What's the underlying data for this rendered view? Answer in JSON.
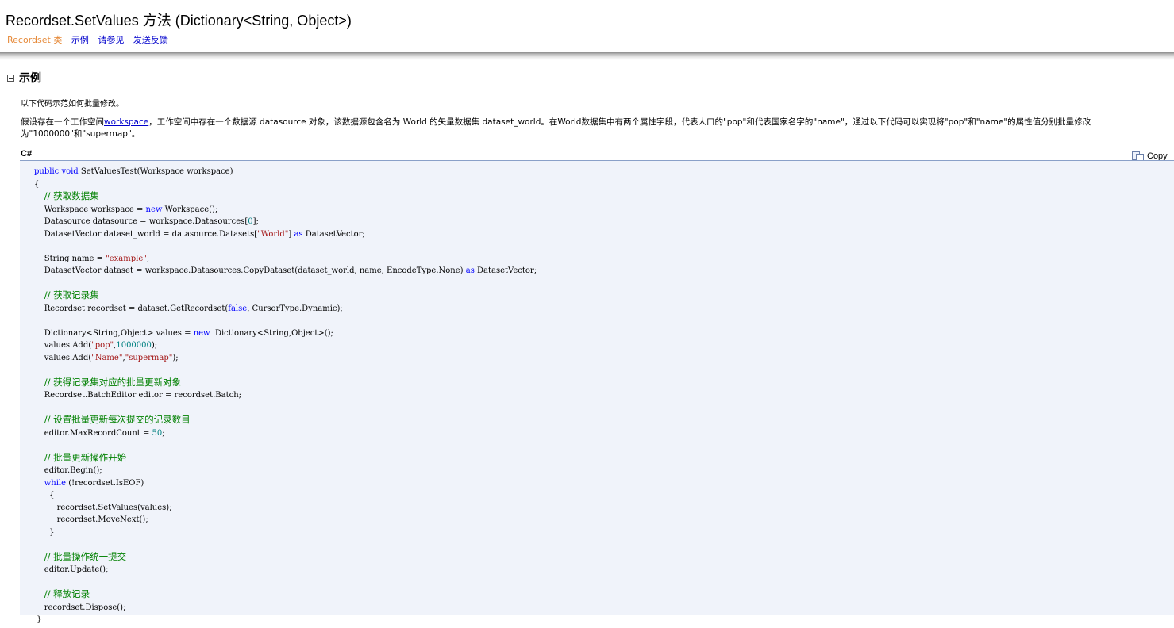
{
  "header": {
    "title": "Recordset.SetValues 方法 (Dictionary<String, Object>)",
    "links": [
      {
        "label": "Recordset 类",
        "visited": true
      },
      {
        "label": "示例",
        "visited": false
      },
      {
        "label": "请参见",
        "visited": false
      },
      {
        "label": "发送反馈",
        "visited": false
      }
    ]
  },
  "section": {
    "title": "示例",
    "intro1": "以下代码示范如何批量修改。",
    "intro2_prefix": "假设存在一个工作空间",
    "intro2_link": "workspace",
    "intro2_suffix": "，工作空间中存在一个数据源 datasource 对象，该数据源包含名为 World 的矢量数据集 dataset_world。在World数据集中有两个属性字段，代表人口的\"pop\"和代表国家名字的\"name\"，通过以下代码可以实现将\"pop\"和\"name\"的属性值分别批量修改为\"1000000\"和\"supermap\"。",
    "language": "C#",
    "copy_label": "Copy"
  },
  "code": {
    "lines": [
      [
        {
          "t": "kw",
          "v": "public"
        },
        {
          "t": "txt",
          "v": " "
        },
        {
          "t": "kw",
          "v": "void"
        },
        {
          "t": "txt",
          "v": " SetValuesTest(Workspace workspace)"
        }
      ],
      [
        {
          "t": "txt",
          "v": "{"
        }
      ],
      [
        {
          "t": "txt",
          "v": "    "
        },
        {
          "t": "cm",
          "v": "// 获取数据集"
        }
      ],
      [
        {
          "t": "txt",
          "v": "    Workspace workspace = "
        },
        {
          "t": "kw",
          "v": "new"
        },
        {
          "t": "txt",
          "v": " Workspace();"
        }
      ],
      [
        {
          "t": "txt",
          "v": "    Datasource datasource = workspace.Datasources["
        },
        {
          "t": "num",
          "v": "0"
        },
        {
          "t": "txt",
          "v": "];"
        }
      ],
      [
        {
          "t": "txt",
          "v": "    DatasetVector dataset_world = datasource.Datasets["
        },
        {
          "t": "str",
          "v": "\"World\""
        },
        {
          "t": "txt",
          "v": "] "
        },
        {
          "t": "kw",
          "v": "as"
        },
        {
          "t": "txt",
          "v": " DatasetVector;"
        }
      ],
      [
        {
          "t": "txt",
          "v": ""
        }
      ],
      [
        {
          "t": "txt",
          "v": "    String name = "
        },
        {
          "t": "str",
          "v": "\"example\""
        },
        {
          "t": "txt",
          "v": ";"
        }
      ],
      [
        {
          "t": "txt",
          "v": "    DatasetVector dataset = workspace.Datasources.CopyDataset(dataset_world, name, EncodeType.None) "
        },
        {
          "t": "kw",
          "v": "as"
        },
        {
          "t": "txt",
          "v": " DatasetVector;"
        }
      ],
      [
        {
          "t": "txt",
          "v": ""
        }
      ],
      [
        {
          "t": "txt",
          "v": "    "
        },
        {
          "t": "cm",
          "v": "// 获取记录集"
        }
      ],
      [
        {
          "t": "txt",
          "v": "    Recordset recordset = dataset.GetRecordset("
        },
        {
          "t": "kw",
          "v": "false"
        },
        {
          "t": "txt",
          "v": ", CursorType.Dynamic);"
        }
      ],
      [
        {
          "t": "txt",
          "v": ""
        }
      ],
      [
        {
          "t": "txt",
          "v": "    Dictionary<String,Object> values = "
        },
        {
          "t": "kw",
          "v": "new"
        },
        {
          "t": "txt",
          "v": "  Dictionary<String,Object>();"
        }
      ],
      [
        {
          "t": "txt",
          "v": "    values.Add("
        },
        {
          "t": "str",
          "v": "\"pop\""
        },
        {
          "t": "txt",
          "v": ","
        },
        {
          "t": "num",
          "v": "1000000"
        },
        {
          "t": "txt",
          "v": ");"
        }
      ],
      [
        {
          "t": "txt",
          "v": "    values.Add("
        },
        {
          "t": "str",
          "v": "\"Name\""
        },
        {
          "t": "txt",
          "v": ","
        },
        {
          "t": "str",
          "v": "\"supermap\""
        },
        {
          "t": "txt",
          "v": ");"
        }
      ],
      [
        {
          "t": "txt",
          "v": ""
        }
      ],
      [
        {
          "t": "txt",
          "v": "    "
        },
        {
          "t": "cm",
          "v": "// 获得记录集对应的批量更新对象"
        }
      ],
      [
        {
          "t": "txt",
          "v": "    Recordset.BatchEditor editor = recordset.Batch;"
        }
      ],
      [
        {
          "t": "txt",
          "v": ""
        }
      ],
      [
        {
          "t": "txt",
          "v": "    "
        },
        {
          "t": "cm",
          "v": "// 设置批量更新每次提交的记录数目"
        }
      ],
      [
        {
          "t": "txt",
          "v": "    editor.MaxRecordCount = "
        },
        {
          "t": "num",
          "v": "50"
        },
        {
          "t": "txt",
          "v": ";"
        }
      ],
      [
        {
          "t": "txt",
          "v": ""
        }
      ],
      [
        {
          "t": "txt",
          "v": "    "
        },
        {
          "t": "cm",
          "v": "// 批量更新操作开始"
        }
      ],
      [
        {
          "t": "txt",
          "v": "    editor.Begin();"
        }
      ],
      [
        {
          "t": "txt",
          "v": "    "
        },
        {
          "t": "kw",
          "v": "while"
        },
        {
          "t": "txt",
          "v": " (!recordset.IsEOF)"
        }
      ],
      [
        {
          "t": "txt",
          "v": "      {"
        }
      ],
      [
        {
          "t": "txt",
          "v": "         recordset.SetValues(values);"
        }
      ],
      [
        {
          "t": "txt",
          "v": "         recordset.MoveNext();"
        }
      ],
      [
        {
          "t": "txt",
          "v": "      }"
        }
      ],
      [
        {
          "t": "txt",
          "v": ""
        }
      ],
      [
        {
          "t": "txt",
          "v": "    "
        },
        {
          "t": "cm",
          "v": "// 批量操作统一提交"
        }
      ],
      [
        {
          "t": "txt",
          "v": "    editor.Update();"
        }
      ],
      [
        {
          "t": "txt",
          "v": ""
        }
      ],
      [
        {
          "t": "txt",
          "v": "    "
        },
        {
          "t": "cm",
          "v": "// 释放记录"
        }
      ],
      [
        {
          "t": "txt",
          "v": "    recordset.Dispose();"
        }
      ],
      [
        {
          "t": "txt",
          "v": " }"
        }
      ]
    ]
  }
}
